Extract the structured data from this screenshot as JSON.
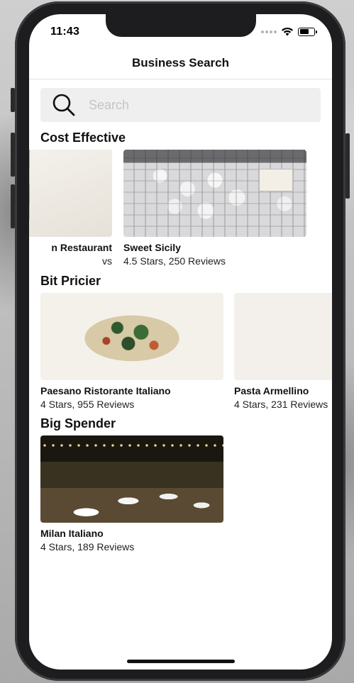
{
  "status_bar": {
    "time": "11:43"
  },
  "nav": {
    "title": "Business Search"
  },
  "search": {
    "placeholder": "Search",
    "value": ""
  },
  "sections": [
    {
      "title": "Cost Effective",
      "cards": [
        {
          "name": "n Restaurant",
          "meta": "vs",
          "image": "bread-photo"
        },
        {
          "name": "Sweet Sicily",
          "meta": "4.5 Stars, 250 Reviews",
          "image": "almond-pastries-photo"
        }
      ]
    },
    {
      "title": "Bit Pricier",
      "cards": [
        {
          "name": "Paesano Ristorante Italiano",
          "meta": "4 Stars, 955 Reviews",
          "image": "pasta-greens-photo"
        },
        {
          "name": "Pasta Armellino",
          "meta": "4 Stars, 231 Reviews",
          "image": "pasta-fork-photo"
        }
      ]
    },
    {
      "title": "Big Spender",
      "cards": [
        {
          "name": "Milan Italiano",
          "meta": "4 Stars, 189 Reviews",
          "image": "patio-night-photo"
        }
      ]
    }
  ],
  "colors": {
    "search_bg": "#efefef",
    "text": "#111111",
    "divider": "#e2e2e2"
  }
}
